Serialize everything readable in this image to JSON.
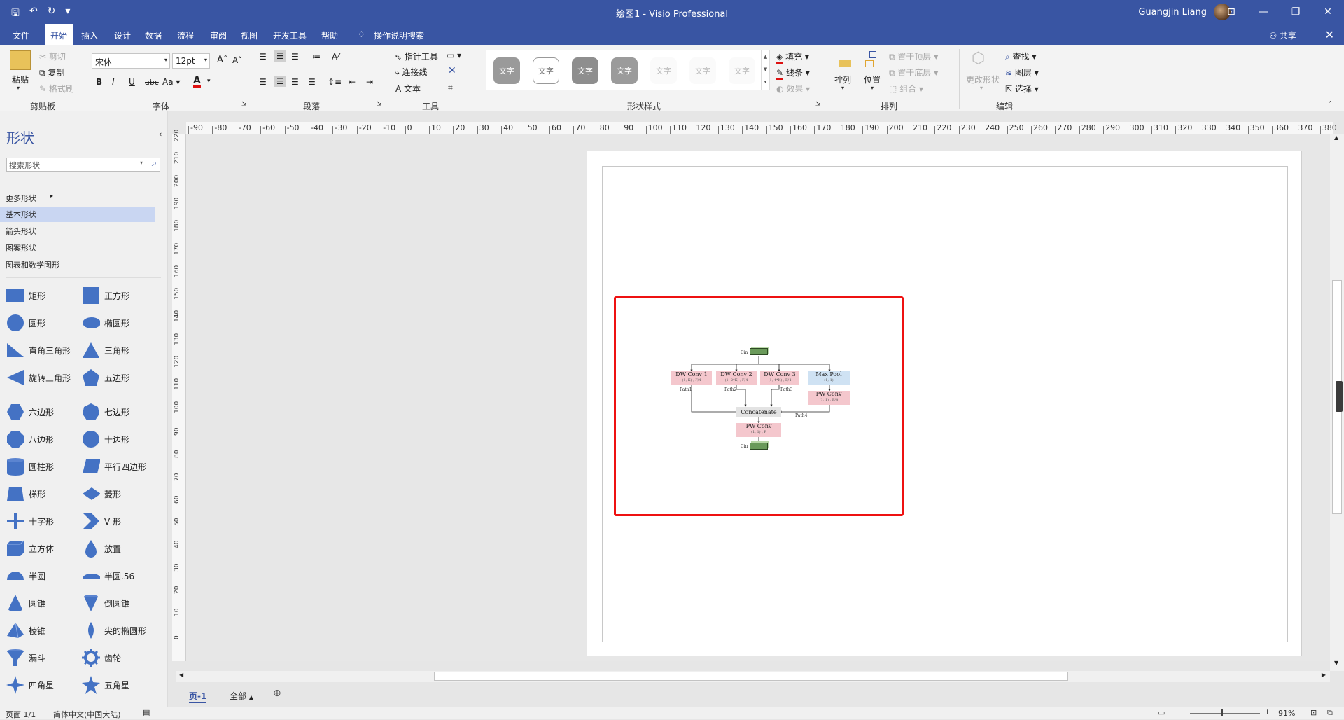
{
  "window": {
    "title": "绘图1  -  Visio Professional",
    "user": "Guangjin Liang"
  },
  "menu": {
    "items": [
      "文件",
      "开始",
      "插入",
      "设计",
      "数据",
      "流程",
      "审阅",
      "视图",
      "开发工具",
      "帮助"
    ],
    "tell_me": "操作说明搜索",
    "share": "共享"
  },
  "ribbon": {
    "clipboard": {
      "paste": "粘贴",
      "cut": "剪切",
      "copy": "复制",
      "format_painter": "格式刷",
      "label": "剪贴板"
    },
    "font": {
      "name": "宋体",
      "size": "12pt",
      "label": "字体",
      "bold": "B",
      "italic": "I",
      "underline": "U",
      "strike": "abc",
      "case": "Aa",
      "color": "A"
    },
    "paragraph": {
      "label": "段落"
    },
    "tools": {
      "pointer": "指针工具",
      "connector": "连接线",
      "text": "文本",
      "label": "工具"
    },
    "shape_styles": {
      "swatch_text": "文字",
      "fill": "填充",
      "line": "线条",
      "effects": "效果",
      "label": "形状样式"
    },
    "arrange": {
      "align": "排列",
      "position": "位置",
      "bring_front": "置于顶层",
      "send_back": "置于底层",
      "group": "组合",
      "label": "排列"
    },
    "editing": {
      "change_shape": "更改形状",
      "find": "查找",
      "layers": "图层",
      "select": "选择",
      "label": "编辑"
    }
  },
  "shapes_panel": {
    "title": "形状",
    "search_placeholder": "搜索形状",
    "stencils": [
      "更多形状",
      "基本形状",
      "箭头形状",
      "图案形状",
      "图表和数学图形"
    ],
    "selected_stencil": "基本形状",
    "items": [
      [
        "矩形",
        "正方形"
      ],
      [
        "圆形",
        "椭圆形"
      ],
      [
        "直角三角形",
        "三角形"
      ],
      [
        "旋转三角形",
        "五边形"
      ],
      [
        "六边形",
        "七边形"
      ],
      [
        "八边形",
        "十边形"
      ],
      [
        "圆柱形",
        "平行四边形"
      ],
      [
        "梯形",
        "菱形"
      ],
      [
        "十字形",
        "V 形"
      ],
      [
        "立方体",
        "放置"
      ],
      [
        "半圆",
        "半圆.56"
      ],
      [
        "圆锥",
        "倒圆锥"
      ],
      [
        "棱锥",
        "尖的椭圆形"
      ],
      [
        "漏斗",
        "齿轮"
      ],
      [
        "四角星",
        "五角星"
      ]
    ]
  },
  "rulers": {
    "top": [
      "-90",
      "-80",
      "-70",
      "-60",
      "-50",
      "-40",
      "-30",
      "-20",
      "-10",
      "0",
      "10",
      "20",
      "30",
      "40",
      "50",
      "60",
      "70",
      "80",
      "90",
      "100",
      "110",
      "120",
      "130",
      "140",
      "150",
      "160",
      "170",
      "180",
      "190",
      "200",
      "210",
      "220",
      "230",
      "240",
      "250",
      "260",
      "270",
      "280",
      "290",
      "300",
      "310",
      "320",
      "330",
      "340",
      "350",
      "360",
      "370",
      "380"
    ],
    "left": [
      "220",
      "210",
      "200",
      "190",
      "180",
      "170",
      "160",
      "150",
      "140",
      "130",
      "120",
      "110",
      "100",
      "90",
      "80",
      "70",
      "60",
      "50",
      "40",
      "30",
      "20",
      "10",
      "0"
    ]
  },
  "diagram": {
    "input_label": "Cin",
    "path_labels": [
      "Path1",
      "Path2",
      "Path3",
      "Path4"
    ],
    "nodes": [
      {
        "title": "DW Conv 1",
        "sub": "(1, K) , F/4"
      },
      {
        "title": "DW Conv 2",
        "sub": "(1, 2*K) , F/4"
      },
      {
        "title": "DW Conv 3",
        "sub": "(1, 4*K) , F/4"
      },
      {
        "title": "Max Pool",
        "sub": "(1, 1)"
      },
      {
        "title": "PW Conv",
        "sub": "(1, 1) , F/4"
      },
      {
        "title": "Concatenate",
        "sub": ""
      },
      {
        "title": "PW Conv",
        "sub": "(1, 1) , F"
      }
    ]
  },
  "tabs": {
    "page": "页-1",
    "all": "全部"
  },
  "status": {
    "page": "页面 1/1",
    "language": "简体中文(中国大陆)",
    "zoom": "91%"
  }
}
